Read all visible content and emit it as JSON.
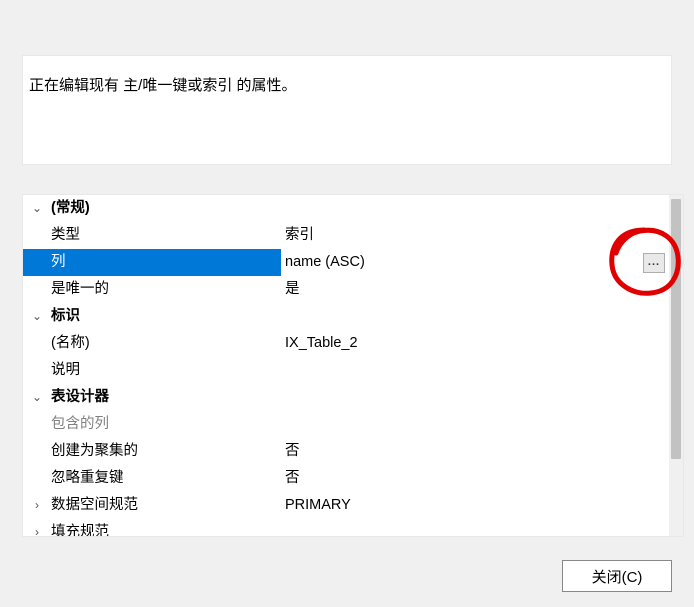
{
  "description": "正在编辑现有 主/唯一键或索引 的属性。",
  "categories": {
    "general": "(常规)",
    "identity": "标识",
    "designer": "表设计器"
  },
  "props": {
    "type": {
      "label": "类型",
      "value": "索引"
    },
    "columns": {
      "label": "列",
      "value": "name (ASC)"
    },
    "isUnique": {
      "label": "是唯一的",
      "value": "是"
    },
    "name": {
      "label": "(名称)",
      "value": "IX_Table_2"
    },
    "desc": {
      "label": "说明",
      "value": ""
    },
    "included": {
      "label": "包含的列",
      "value": ""
    },
    "clustered": {
      "label": "创建为聚集的",
      "value": "否"
    },
    "ignoreDup": {
      "label": "忽略重复键",
      "value": "否"
    },
    "dataSpace": {
      "label": "数据空间规范",
      "value": "PRIMARY"
    },
    "fillSpec": {
      "label": "填充规范",
      "value": ""
    }
  },
  "ellipsis": "...",
  "chev": {
    "down": "⌄",
    "right": "›"
  },
  "closeButton": "关闭(C)"
}
